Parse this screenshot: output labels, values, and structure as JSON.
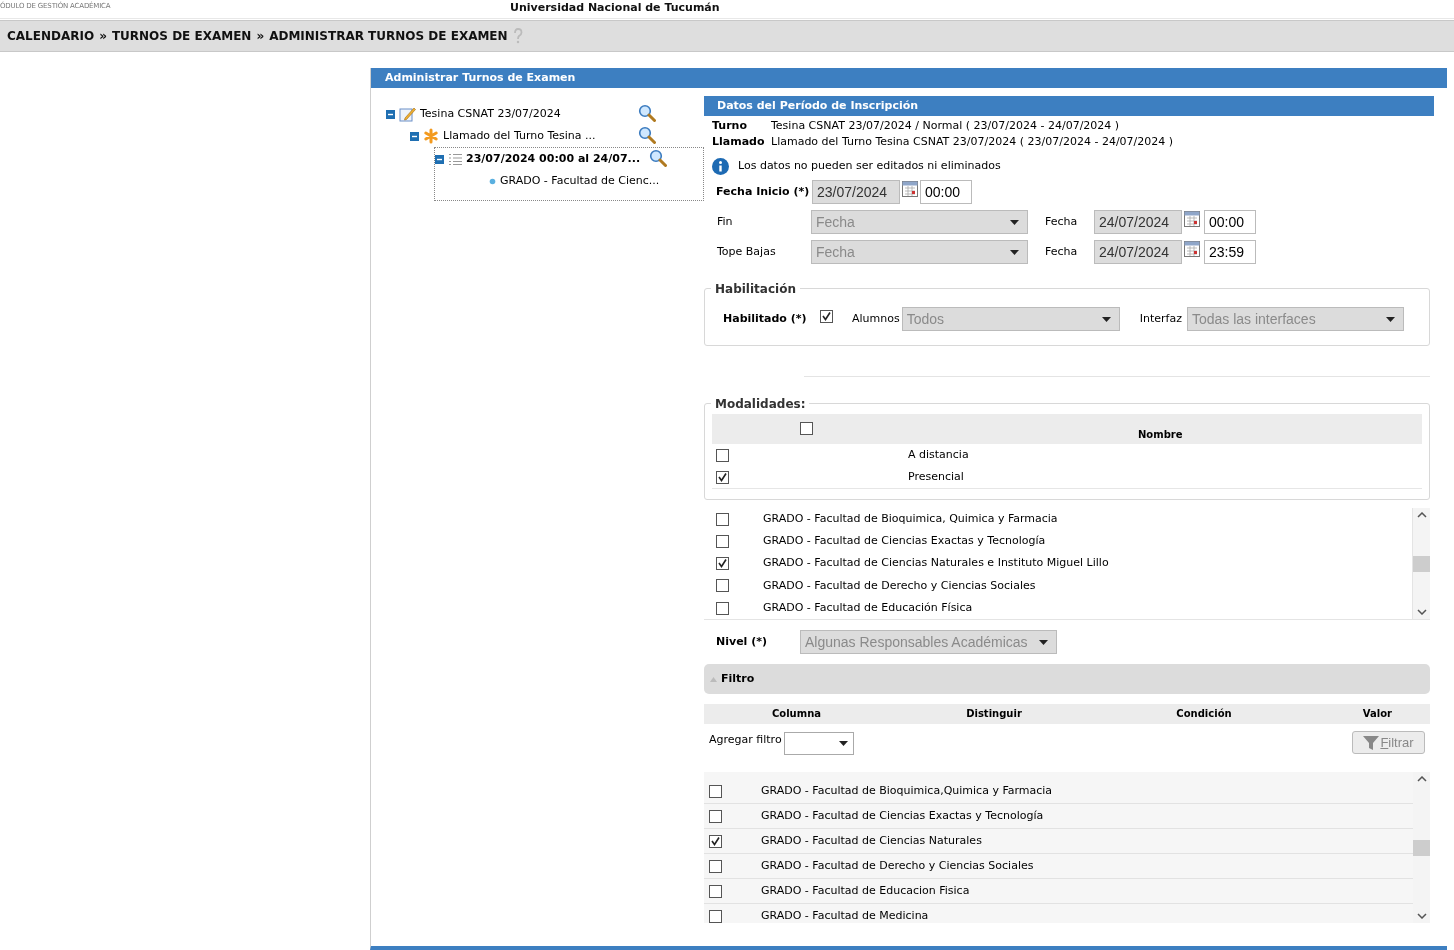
{
  "header": {
    "module": "ÓDULO DE GESTIÓN ACADÉMICA",
    "university": "Universidad Nacional de Tucumán"
  },
  "breadcrumb": [
    {
      "label": "CALENDARIO",
      "separator": "»"
    },
    {
      "label": "TURNOS DE EXAMEN",
      "separator": "»"
    },
    {
      "label": "ADMINISTRAR TURNOS DE EXAMEN"
    }
  ],
  "panel_title": "Administrar Turnos de Examen",
  "tree": [
    {
      "kind": "turno",
      "label": "Tesina CSNAT 23/07/2024",
      "selected": false,
      "children": [
        {
          "kind": "llamado",
          "label": "Llamado del Turno Tesina ...",
          "selected": false,
          "children": [
            {
              "kind": "periodo",
              "label": "23/07/2024 00:00 al 24/07...",
              "selected": true,
              "children": [
                {
                  "kind": "item",
                  "label": "GRADO - Facultad de Cienc...",
                  "selected": false
                }
              ]
            }
          ]
        }
      ]
    }
  ],
  "section_title": "Datos del Período de Inscripción",
  "info": [
    {
      "label": "Turno",
      "value": "Tesina CSNAT 23/07/2024 / Normal ( 23/07/2024 - 24/07/2024 )"
    },
    {
      "label": "Llamado",
      "value": "Llamado del Turno Tesina CSNAT 23/07/2024 ( 23/07/2024 - 24/07/2024 )"
    }
  ],
  "notice": "Los datos no pueden ser editados ni eliminados",
  "fecha_inicio": {
    "label": "Fecha Inicio (*)",
    "date": "23/07/2024",
    "time": "00:00"
  },
  "date_rows": [
    {
      "label": "Fin",
      "select": "Fecha",
      "date_label": "Fecha",
      "date": "24/07/2024",
      "time": "00:00"
    },
    {
      "label": "Tope Bajas",
      "select": "Fecha",
      "date_label": "Fecha",
      "date": "24/07/2024",
      "time": "23:59"
    }
  ],
  "habilitacion": {
    "legend": "Habilitación",
    "label": "Habilitado (*)",
    "checked": true,
    "alumnos_label": "Alumnos",
    "alumnos": "Todos",
    "interfaz_label": "Interfaz",
    "interfaz": "Todas las interfaces"
  },
  "modalidades": {
    "legend": "Modalidades:",
    "all_checked": false,
    "column": "Nombre",
    "rows": [
      {
        "name": "A distancia",
        "checked": false
      },
      {
        "name": "Presencial",
        "checked": true
      }
    ]
  },
  "responsables": [
    {
      "name": "GRADO - Facultad de Bioquimica, Quimica y Farmacia",
      "checked": false
    },
    {
      "name": "GRADO - Facultad de Ciencias Exactas y Tecnología",
      "checked": false
    },
    {
      "name": "GRADO - Facultad de Ciencias Naturales e Instituto Miguel Lillo",
      "checked": true
    },
    {
      "name": "GRADO - Facultad de Derecho y Ciencias Sociales",
      "checked": false
    },
    {
      "name": "GRADO - Facultad de Educación Física",
      "checked": false
    }
  ],
  "nivel": {
    "label": "Nivel (*)",
    "value": "Algunas Responsables Académicas"
  },
  "filtro": {
    "title": "Filtro",
    "columns": [
      "Columna",
      "Distinguir",
      "Condición",
      "Valor"
    ],
    "add_label": "Agregar filtro",
    "button": "Filtrar"
  },
  "results": [
    {
      "name": "GRADO - Facultad de Bioquimica,Quimica y Farmacia",
      "checked": false
    },
    {
      "name": "GRADO - Facultad de Ciencias Exactas y Tecnología",
      "checked": false
    },
    {
      "name": "GRADO - Facultad de Ciencias Naturales",
      "checked": true
    },
    {
      "name": "GRADO - Facultad de Derecho y Ciencias Sociales",
      "checked": false
    },
    {
      "name": "GRADO - Facultad de Educacion Fisica",
      "checked": false
    },
    {
      "name": "GRADO - Facultad de Medicina",
      "checked": false
    }
  ]
}
